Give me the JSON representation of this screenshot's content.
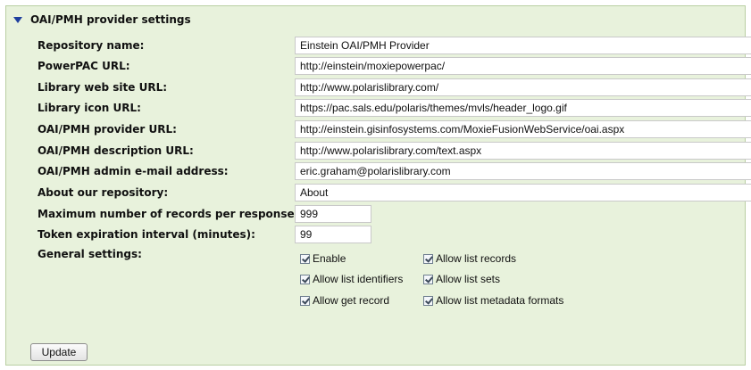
{
  "section": {
    "title": "OAI/PMH provider settings"
  },
  "fields": [
    {
      "label": "Repository name:",
      "value": "Einstein OAI/PMH Provider"
    },
    {
      "label": "PowerPAC URL:",
      "value": "http://einstein/moxiepowerpac/"
    },
    {
      "label": "Library web site URL:",
      "value": "http://www.polarislibrary.com/"
    },
    {
      "label": "Library icon URL:",
      "value": "https://pac.sals.edu/polaris/themes/mvls/header_logo.gif"
    },
    {
      "label": "OAI/PMH provider URL:",
      "value": "http://einstein.gisinfosystems.com/MoxieFusionWebService/oai.aspx"
    },
    {
      "label": "OAI/PMH description URL:",
      "value": "http://www.polarislibrary.com/text.aspx"
    },
    {
      "label": "OAI/PMH admin e-mail address:",
      "value": "eric.graham@polarislibrary.com"
    },
    {
      "label": "About our repository:",
      "value": "About"
    },
    {
      "label": "Maximum number of records per response:",
      "value": "999"
    },
    {
      "label": "Token expiration interval (minutes):",
      "value": "99"
    }
  ],
  "general": {
    "label": "General settings:",
    "options": [
      {
        "label": "Enable",
        "checked": true
      },
      {
        "label": "Allow list records",
        "checked": true
      },
      {
        "label": "Allow list identifiers",
        "checked": true
      },
      {
        "label": "Allow list sets",
        "checked": true
      },
      {
        "label": "Allow get record",
        "checked": true
      },
      {
        "label": "Allow list metadata formats",
        "checked": true
      }
    ]
  },
  "actions": {
    "update_label": "Update"
  },
  "colors": {
    "panel_bg": "#e8f2dc",
    "panel_border": "#b9cfa3",
    "triangle": "#1f3f9e"
  }
}
